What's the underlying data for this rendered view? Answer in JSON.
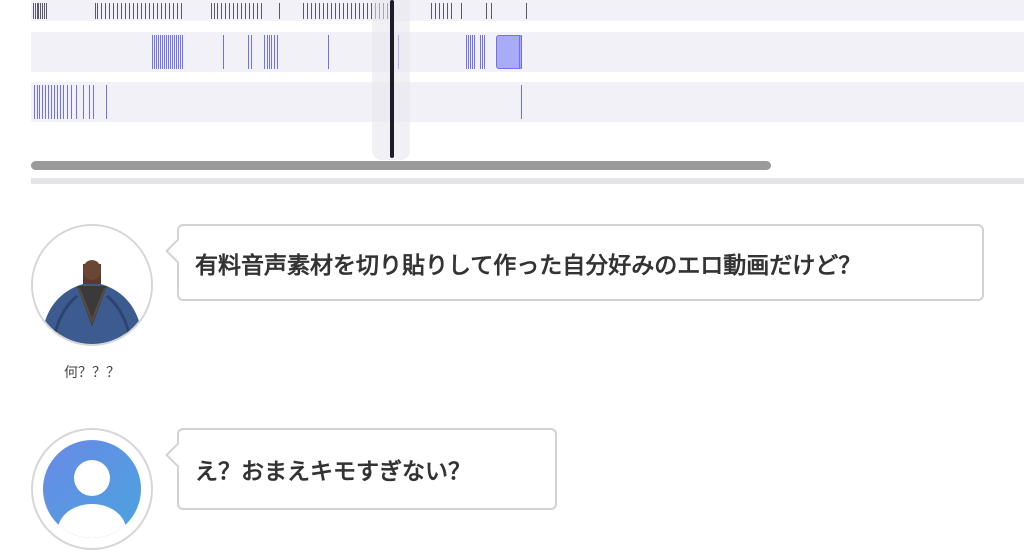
{
  "timeline": {
    "tracks": [
      {
        "name": "track-1",
        "tick_positions": [
          2,
          4,
          6,
          7,
          9,
          11,
          13,
          15,
          64,
          66,
          70,
          74,
          78,
          82,
          86,
          90,
          94,
          98,
          102,
          106,
          110,
          114,
          118,
          122,
          126,
          130,
          134,
          138,
          142,
          146,
          150,
          180,
          183,
          186,
          190,
          194,
          198,
          202,
          206,
          210,
          214,
          218,
          222,
          226,
          230,
          248,
          272,
          276,
          280,
          284,
          288,
          292,
          296,
          300,
          304,
          308,
          312,
          316,
          320,
          324,
          328,
          332,
          336,
          340,
          344,
          348,
          352,
          356,
          400,
          404,
          408,
          412,
          416,
          420,
          430,
          455,
          460,
          495
        ]
      },
      {
        "name": "track-2",
        "tick_positions": [
          121,
          123,
          125,
          127,
          129,
          131,
          133,
          135,
          137,
          139,
          141,
          143,
          145,
          147,
          149,
          151,
          192,
          217,
          220,
          233,
          236,
          238,
          240,
          243,
          246,
          297,
          367,
          435,
          437,
          439,
          441,
          443,
          449,
          451,
          453,
          488,
          490
        ]
      },
      {
        "name": "track-3",
        "tick_positions": [
          3,
          6,
          8,
          11,
          14,
          17,
          20,
          23,
          26,
          29,
          32,
          36,
          40,
          45,
          52,
          58,
          62,
          75,
          490
        ]
      }
    ],
    "playhead_label": ""
  },
  "messages": [
    {
      "avatar_kind": "photo",
      "name": "何？？？",
      "text": "有料音声素材を切り貼りして作った自分好みのエロ動画だけど？"
    },
    {
      "avatar_kind": "default-user",
      "name": "",
      "text": "え？おまえキモすぎない？"
    }
  ]
}
